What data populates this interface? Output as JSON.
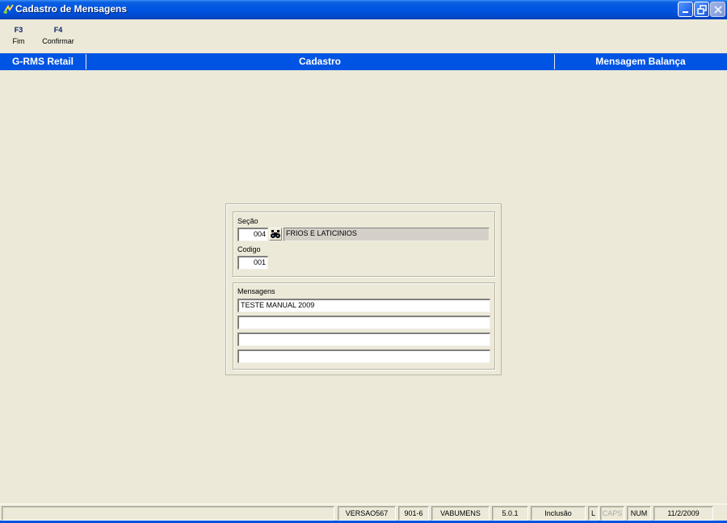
{
  "window": {
    "title": "Cadastro de Mensagens",
    "icon": "app-logo-icon",
    "controls": [
      "minimize-icon",
      "restore-icon",
      "close-icon"
    ]
  },
  "toolbar": {
    "keys": [
      {
        "key": "F3",
        "label": "Fim"
      },
      {
        "key": "F4",
        "label": "Confirmar"
      }
    ]
  },
  "header": {
    "left": "G-RMS Retail",
    "center": "Cadastro",
    "right": "Mensagem Balança"
  },
  "form": {
    "secao_label": "Seção",
    "secao_code": "004",
    "secao_name": "FRIOS E LATICINIOS",
    "codigo_label": "Codigo",
    "codigo_value": "001",
    "mensagens_label": "Mensagens",
    "mensagens": [
      "TESTE MANUAL 2009",
      "",
      "",
      ""
    ]
  },
  "status": {
    "cells": [
      "",
      "VERSAO567",
      "901-6",
      "VABUMENS",
      "5.0.1",
      "Inclusão",
      "L",
      "CAPS",
      "NUM",
      "11/2/2009"
    ]
  },
  "colors": {
    "accent": "#0054e3",
    "background": "#ece9d8"
  }
}
